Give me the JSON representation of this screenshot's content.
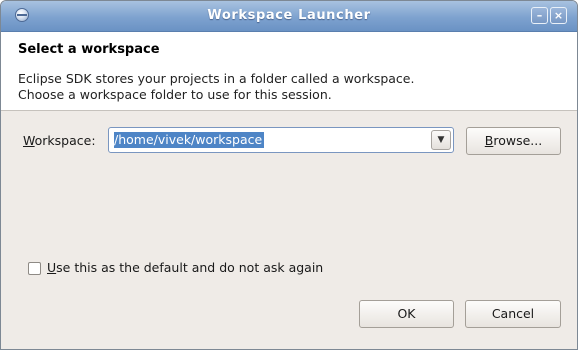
{
  "window": {
    "title": "Workspace Launcher",
    "minimize_symbol": "–",
    "close_symbol": "×",
    "app_icon": "eclipse-icon"
  },
  "header": {
    "title": "Select a workspace",
    "description_line1": "Eclipse SDK stores your projects in a folder called a workspace.",
    "description_line2": "Choose a workspace folder to use for this session."
  },
  "workspace": {
    "label_mnemonic": "W",
    "label_rest": "orkspace:",
    "value": "/home/vivek/workspace",
    "dropdown_icon": "chevron-down-icon",
    "dropdown_symbol": "▼",
    "browse_mnemonic": "B",
    "browse_rest": "rowse..."
  },
  "default_option": {
    "checked": false,
    "label_mnemonic": "U",
    "label_rest": "se this as the default and do not ask again"
  },
  "buttons": {
    "ok_label": "OK",
    "cancel_label": "Cancel"
  },
  "colors": {
    "titlebar": "#7ea2cf",
    "selection": "#4e85c6",
    "dialog_background": "#efebe7"
  }
}
